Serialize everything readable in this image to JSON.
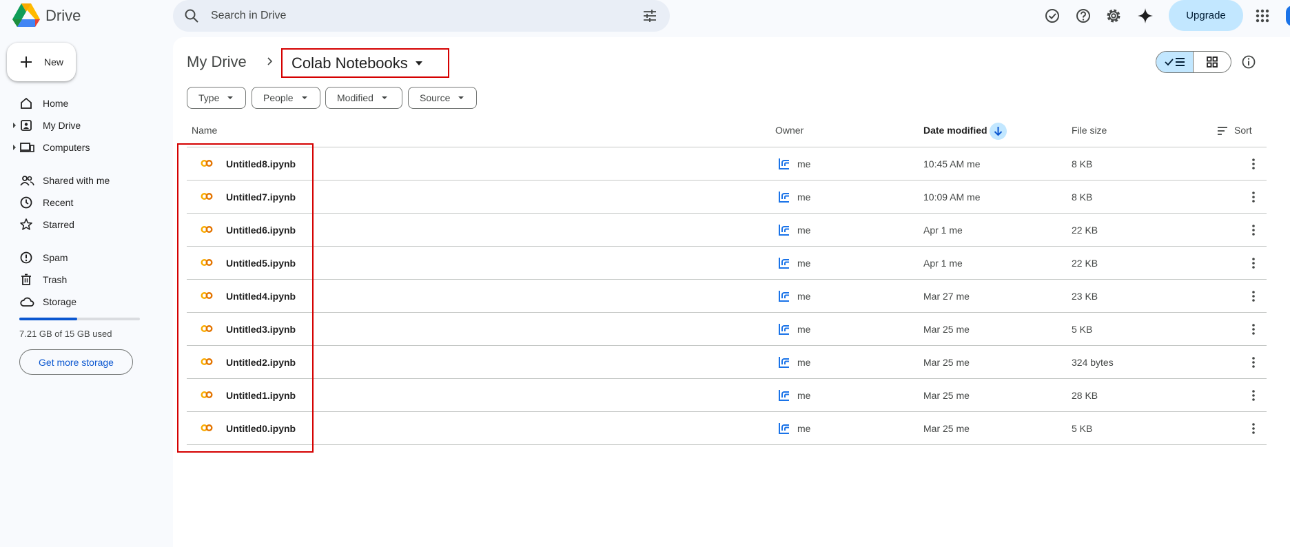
{
  "app": {
    "title": "Drive"
  },
  "search": {
    "placeholder": "Search in Drive",
    "value": ""
  },
  "header": {
    "upgrade_label": "Upgrade"
  },
  "sidebar": {
    "new_label": "New",
    "items": [
      {
        "label": "Home",
        "icon": "home-icon"
      },
      {
        "label": "My Drive",
        "icon": "my-drive-icon",
        "expandable": true
      },
      {
        "label": "Computers",
        "icon": "computers-icon",
        "expandable": true
      },
      {
        "label": "Shared with me",
        "icon": "shared-icon"
      },
      {
        "label": "Recent",
        "icon": "clock-icon"
      },
      {
        "label": "Starred",
        "icon": "star-icon"
      },
      {
        "label": "Spam",
        "icon": "spam-icon"
      },
      {
        "label": "Trash",
        "icon": "trash-icon"
      },
      {
        "label": "Storage",
        "icon": "cloud-icon"
      }
    ],
    "storage": {
      "used_text": "7.21 GB of 15 GB used",
      "used_fraction": 0.48,
      "button_label": "Get more storage"
    }
  },
  "breadcrumb": {
    "root": "My Drive",
    "current": "Colab Notebooks"
  },
  "filters": [
    "Type",
    "People",
    "Modified",
    "Source"
  ],
  "table": {
    "columns": {
      "name": "Name",
      "owner": "Owner",
      "date_modified": "Date modified",
      "file_size": "File size",
      "sort": "Sort"
    },
    "rows": [
      {
        "name": "Untitled8.ipynb",
        "owner": "me",
        "modified": "10:45 AM me",
        "size": "8 KB"
      },
      {
        "name": "Untitled7.ipynb",
        "owner": "me",
        "modified": "10:09 AM me",
        "size": "8 KB"
      },
      {
        "name": "Untitled6.ipynb",
        "owner": "me",
        "modified": "Apr 1 me",
        "size": "22 KB"
      },
      {
        "name": "Untitled5.ipynb",
        "owner": "me",
        "modified": "Apr 1 me",
        "size": "22 KB"
      },
      {
        "name": "Untitled4.ipynb",
        "owner": "me",
        "modified": "Mar 27 me",
        "size": "23 KB"
      },
      {
        "name": "Untitled3.ipynb",
        "owner": "me",
        "modified": "Mar 25 me",
        "size": "5 KB"
      },
      {
        "name": "Untitled2.ipynb",
        "owner": "me",
        "modified": "Mar 25 me",
        "size": "324 bytes"
      },
      {
        "name": "Untitled1.ipynb",
        "owner": "me",
        "modified": "Mar 25 me",
        "size": "28 KB"
      },
      {
        "name": "Untitled0.ipynb",
        "owner": "me",
        "modified": "Mar 25 me",
        "size": "5 KB"
      }
    ]
  },
  "colors": {
    "accent": "#0b57d0",
    "highlight": "#d50000",
    "selected_bg": "#c2e7ff",
    "colab_orange": "#f9ab00"
  }
}
